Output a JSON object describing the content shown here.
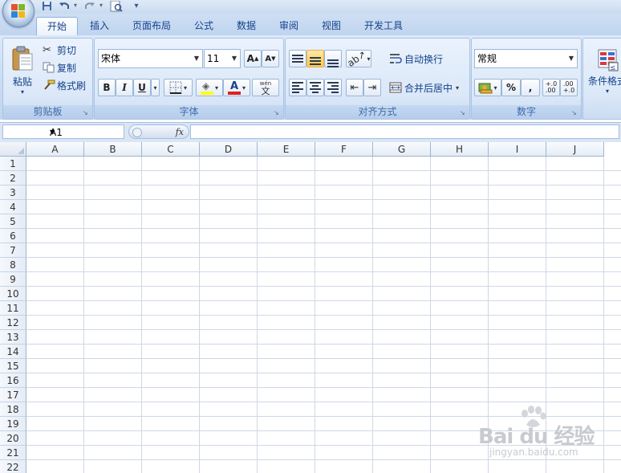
{
  "quick_access": {
    "save_icon": "save-icon",
    "undo_icon": "undo-icon",
    "redo_icon": "redo-icon",
    "print_preview_icon": "print-preview-icon",
    "customize_icon": "chevron-down-icon"
  },
  "tabs": [
    {
      "label": "开始",
      "active": true
    },
    {
      "label": "插入"
    },
    {
      "label": "页面布局"
    },
    {
      "label": "公式"
    },
    {
      "label": "数据"
    },
    {
      "label": "审阅"
    },
    {
      "label": "视图"
    },
    {
      "label": "开发工具"
    }
  ],
  "clipboard": {
    "paste_label": "粘贴",
    "cut_label": "剪切",
    "copy_label": "复制",
    "format_painter_label": "格式刷",
    "group_label": "剪贴板"
  },
  "font": {
    "name": "宋体",
    "size": "11",
    "bold": "B",
    "italic": "I",
    "underline": "U",
    "group_label": "字体",
    "phonetic": "wén",
    "phonetic_char": "文",
    "font_color": "A",
    "fill_color": "#ffff00",
    "text_color": "#e02020"
  },
  "alignment": {
    "wrap_label": "自动换行",
    "merge_label": "合并后居中",
    "group_label": "对齐方式"
  },
  "number": {
    "format": "常规",
    "percent": "%",
    "comma": ",",
    "inc_decimal": "+.0\n.00",
    "dec_decimal": ".00\n+.0",
    "group_label": "数字"
  },
  "styles": {
    "conditional_label": "条件格式"
  },
  "formula_bar": {
    "name_box": "A1",
    "fx": "fx",
    "formula": ""
  },
  "sheet": {
    "columns": [
      "A",
      "B",
      "C",
      "D",
      "E",
      "F",
      "G",
      "H",
      "I",
      "J"
    ],
    "rows": [
      "1",
      "2",
      "3",
      "4",
      "5",
      "6",
      "7",
      "8",
      "9",
      "10",
      "11",
      "12",
      "13",
      "14",
      "15",
      "16",
      "17",
      "18",
      "19",
      "20",
      "21",
      "22"
    ]
  },
  "watermark": {
    "main": "Bai du 经验",
    "sub": "jingyan.baidu.com"
  }
}
